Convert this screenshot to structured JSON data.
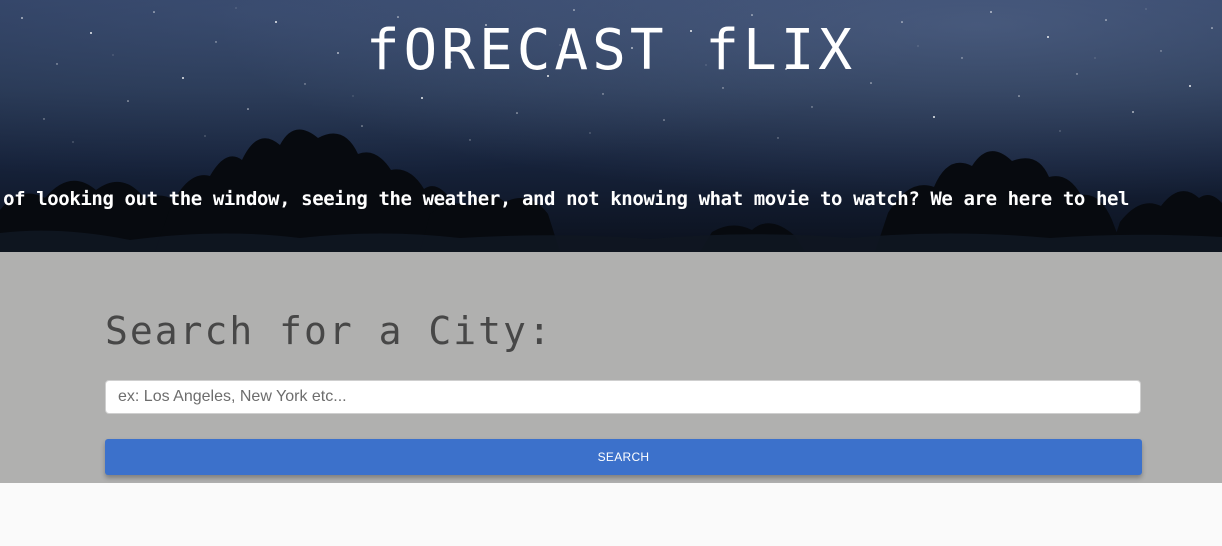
{
  "header": {
    "brand_title": "fORECAST fLIX",
    "marquee_text": "ed of looking out the window, seeing the weather, and not knowing what movie to watch? We are here to hel"
  },
  "search": {
    "heading": "Search for a City:",
    "input_placeholder": "ex: Los Angeles, New York etc...",
    "input_value": "",
    "button_label": "SEARCH"
  },
  "colors": {
    "search_section_bg": "#b0b0af",
    "button_bg": "#3c71cb",
    "page_bg": "#fafafa"
  }
}
